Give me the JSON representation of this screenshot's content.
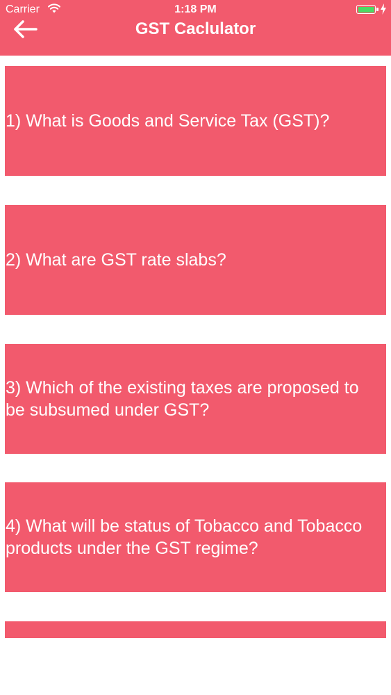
{
  "status_bar": {
    "carrier": "Carrier",
    "time": "1:18 PM",
    "battery_color": "#4cd964",
    "icons": [
      "wifi-icon",
      "battery-icon",
      "charging-bolt-icon"
    ]
  },
  "nav": {
    "title": "GST Caclulator",
    "back_icon": "arrow-left-icon"
  },
  "theme": {
    "accent": "#f25a6d",
    "background": "#ffffff",
    "text_on_accent": "#ffffff"
  },
  "questions": [
    {
      "label": "1) What is Goods and Service Tax (GST)?"
    },
    {
      "label": "2) What are GST rate slabs?"
    },
    {
      "label": "3) Which of the existing taxes are proposed to be subsumed under GST?"
    },
    {
      "label": "4) What will be status of Tobacco and Tobacco products under the GST regime?"
    },
    {
      "label": ""
    }
  ]
}
